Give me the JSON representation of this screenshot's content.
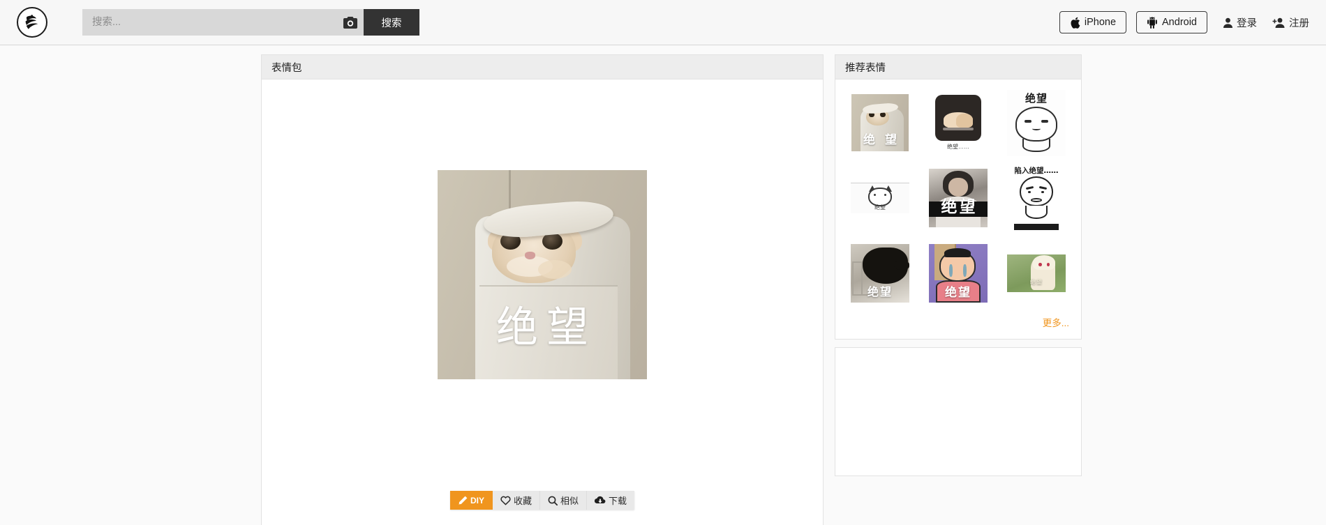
{
  "header": {
    "logo_alt": "逗图 logo",
    "search": {
      "placeholder": "搜索...",
      "value": "",
      "camera_icon": "camera-icon",
      "button_label": "搜索"
    },
    "apps": [
      {
        "label": "iPhone",
        "icon": "apple-icon"
      },
      {
        "label": "Android",
        "icon": "android-icon"
      }
    ],
    "account": [
      {
        "label": "登录",
        "icon": "user-icon"
      },
      {
        "label": "注册",
        "icon": "user-plus-icon"
      }
    ]
  },
  "main": {
    "panel_title": "表情包",
    "image": {
      "caption": "绝望",
      "alt": "猫咪钻进垃圾桶 绝望"
    },
    "actions": [
      {
        "label": "DIY",
        "icon": "pencil-icon",
        "primary": true
      },
      {
        "label": "收藏",
        "icon": "heart-icon",
        "primary": false
      },
      {
        "label": "相似",
        "icon": "magnifier-icon",
        "primary": false
      },
      {
        "label": "下载",
        "icon": "download-cloud-icon",
        "primary": false
      }
    ]
  },
  "sidebar": {
    "panel_title": "推荐表情",
    "more_label": "更多...",
    "recommendations": [
      {
        "caption": "绝 望",
        "alt": "猫咪钻进垃圾桶"
      },
      {
        "caption": "绝望……",
        "alt": "深色方块里的小狗"
      },
      {
        "caption": "绝望",
        "alt": "白色简笔小人"
      },
      {
        "caption": "绝望",
        "alt": "白猫简笔画"
      },
      {
        "caption": "绝望",
        "alt": "黑白人物照片"
      },
      {
        "caption": "陷入绝望……",
        "alt": "简笔画男子托腮"
      },
      {
        "caption": "绝望",
        "alt": "黑猫趴在栏杆上"
      },
      {
        "caption": "绝望",
        "alt": "卡通男子流泪"
      },
      {
        "caption": "绝望",
        "alt": "草地上的动漫少女"
      }
    ]
  },
  "colors": {
    "accent": "#f0951e",
    "search_button": "#333333",
    "panel_header": "#ededed",
    "page_background": "#fafafa"
  }
}
